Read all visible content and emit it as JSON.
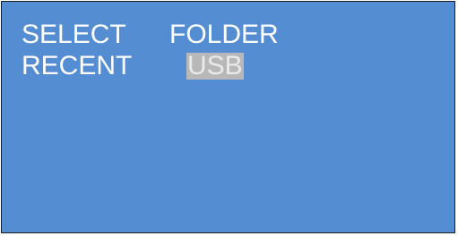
{
  "menu": {
    "row1": {
      "label": "SELECT",
      "value": "FOLDER"
    },
    "row2": {
      "label": "RECENT",
      "value": "USB",
      "value_selected": true
    }
  },
  "colors": {
    "background": "#548dd1",
    "text": "#ffffff",
    "highlight": "#b8b8b8"
  }
}
